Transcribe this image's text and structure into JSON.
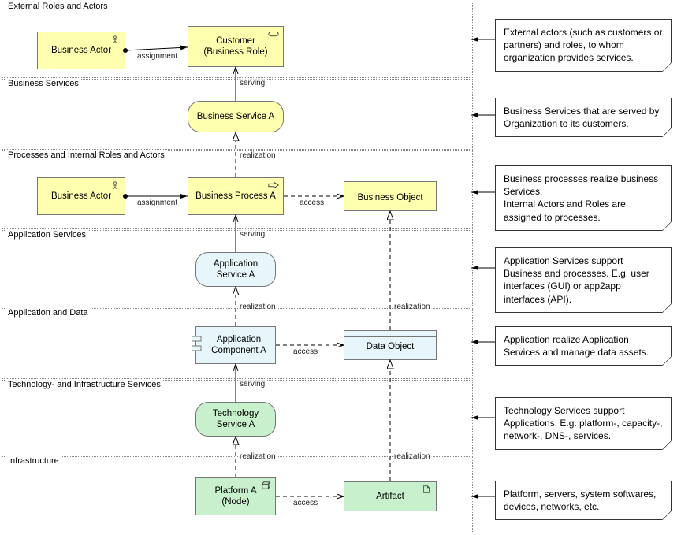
{
  "layers": {
    "external": {
      "label": "External Roles and Actors"
    },
    "bservices": {
      "label": "Business Services"
    },
    "processes": {
      "label": "Processes and Internal Roles and Actors"
    },
    "appsvc": {
      "label": "Application Services"
    },
    "appdata": {
      "label": "Application and Data"
    },
    "techsvc": {
      "label": "Technology- and Infrastructure Services"
    },
    "infra": {
      "label": "Infrastructure"
    }
  },
  "nodes": {
    "ext_actor": {
      "label": "Business Actor"
    },
    "customer": {
      "label": "Customer\n(Business Role)"
    },
    "bservice": {
      "label": "Business Service A"
    },
    "int_actor": {
      "label": "Business Actor"
    },
    "bprocess": {
      "label": "Business Process A"
    },
    "bobject": {
      "label": "Business Object"
    },
    "appservice": {
      "label": "Application\nService A"
    },
    "appcomp": {
      "label": "Application\nComponent A"
    },
    "dataobj": {
      "label": "Data Object"
    },
    "techservice": {
      "label": "Technology\nService A"
    },
    "platform": {
      "label": "Platform A\n(Node)"
    },
    "artifact": {
      "label": "Artifact"
    }
  },
  "edges": {
    "assign1": "assignment",
    "serving1": "serving",
    "real1": "realization",
    "assign2": "assignment",
    "access1": "access",
    "serving2": "serving",
    "real2": "realization",
    "real_do": "realization",
    "access2": "access",
    "serving3": "serving",
    "real3": "realization",
    "real_art": "realization",
    "access3": "access"
  },
  "annotations": {
    "a1": "External actors (such as customers or partners) and roles, to whom organization provides services.",
    "a2": "Business Services that are served by Organization to its customers.",
    "a3": "Business processes realize business Services.\nInternal Actors and Roles are assigned to processes.",
    "a4": "Application Services support Business and processes. E.g. user interfaces (GUI) or app2app interfaces (API).",
    "a5": "Application realize Application Services and manage data assets.",
    "a6": "Technology Services support Applications. E.g. platform-, capacity-, network-, DNS-, services.",
    "a7": "Platform, servers, system softwares, devices, networks, etc."
  }
}
